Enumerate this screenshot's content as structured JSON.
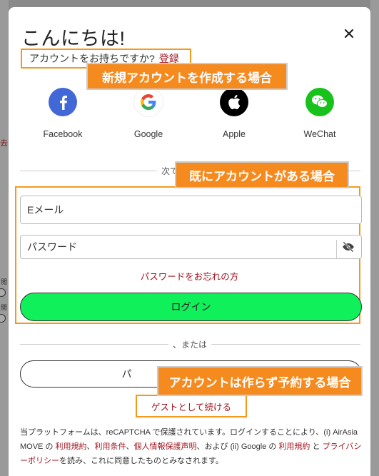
{
  "background": {
    "fragment_char": "去",
    "radio_label_1": "閲",
    "radio_label_2": "閲"
  },
  "modal": {
    "title": "こんにちは!",
    "close_icon": "close-icon",
    "signup_question": "アカウントをお持ちですか?",
    "signup_link": "登録"
  },
  "annotations": {
    "create_account": "新規アカウントを作成する場合",
    "existing_account": "既にアカウントがある場合",
    "guest": "アカウントは作らず予約する場合"
  },
  "social": [
    {
      "label": "Facebook",
      "icon": "facebook-icon",
      "color": "#4267d6"
    },
    {
      "label": "Google",
      "icon": "google-icon",
      "color": "#ffffff"
    },
    {
      "label": "Apple",
      "icon": "apple-icon",
      "color": "#000000"
    },
    {
      "label": "WeChat",
      "icon": "wechat-icon",
      "color": "#17c21a"
    }
  ],
  "divider_next": "次で",
  "form": {
    "email_placeholder": "Eメール",
    "password_placeholder": "パスワード",
    "forgot_password": "パスワードをお忘れの方",
    "login_button": "ログイン"
  },
  "divider_or": "、または",
  "guest": {
    "button_partial": "パ",
    "link": "ゲストとして続ける"
  },
  "legal": {
    "text_1": "当プラットフォームは、reCAPTCHA で保護されています。ログインすることにより、(i) AirAsia MOVE の ",
    "link_terms_use": "利用規約",
    "sep_1": "、",
    "link_terms": "利用条件",
    "sep_2": "、",
    "link_privacy_notice": "個人情報保護声明",
    "text_2": "、および (ii) Google の ",
    "link_google_terms": "利用規約",
    "text_3": " と ",
    "link_privacy_policy": "プライバシーポリシー",
    "text_4": "を読み、これに同意したものとみなされます。"
  },
  "colors": {
    "accent_red": "#a0141e",
    "login_green": "#0ff05a",
    "annotation_orange": "#f58a1f"
  }
}
